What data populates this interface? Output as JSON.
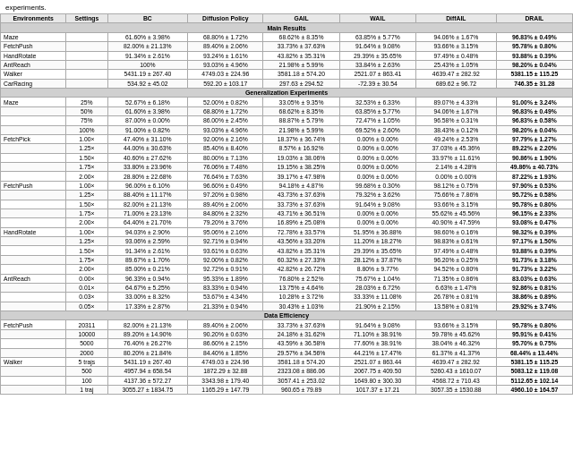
{
  "intro": "experiments.",
  "table": {
    "columns": [
      "Environments",
      "Settings",
      "BC",
      "Diffusion Policy",
      "GAIL",
      "WAIL",
      "DiffAIL",
      "DRAIL"
    ],
    "mainResults": {
      "header": "Main Results",
      "rows": [
        [
          "Maze",
          "",
          "61.60% ± 3.98%",
          "68.80% ± 1.72%",
          "68.62% ± 8.35%",
          "63.85% ± 5.77%",
          "94.06% ± 1.67%",
          "96.83% ± 0.49%"
        ],
        [
          "FetchPush",
          "",
          "82.00% ± 21.13%",
          "89.40% ± 2.06%",
          "33.73% ± 37.63%",
          "91.64% ± 9.08%",
          "93.66% ± 3.15%",
          "95.78% ± 0.80%"
        ],
        [
          "HandRotate",
          "",
          "91.34% ± 2.61%",
          "93.24% ± 1.61%",
          "43.82% ± 35.31%",
          "29.39% ± 35.65%",
          "97.49% ± 0.48%",
          "93.88% ± 0.39%"
        ],
        [
          "AntReach",
          "",
          "100%",
          "93.03% ± 4.96%",
          "21.98% ± 5.99%",
          "33.84% ± 2.63%",
          "25.43% ± 1.05%",
          "98.20% ± 0.04%"
        ],
        [
          "Walker",
          "",
          "5431.19 ± 267.40",
          "4749.03 ± 224.96",
          "3581.18 ± 574.20",
          "2521.07 ± 863.41",
          "4639.47 ± 282.92",
          "5381.15 ± 115.25"
        ],
        [
          "CarRacing",
          "",
          "534.92 ± 45.02",
          "592.20 ± 103.17",
          "297.63 ± 294.52",
          "-72.39 ± 30.54",
          "689.62 ± 96.72",
          "746.35 ± 31.28"
        ]
      ]
    },
    "genExperiments": {
      "header": "Generalization Experiments",
      "mazeRows": [
        [
          "Maze",
          "25%",
          "52.67% ± 6.18%",
          "52.00% ± 0.82%",
          "33.05% ± 9.35%",
          "32.53% ± 6.33%",
          "89.07% ± 4.33%",
          "91.00% ± 3.24%"
        ],
        [
          "",
          "50%",
          "61.60% ± 3.98%",
          "68.80% ± 1.72%",
          "68.62% ± 8.35%",
          "63.85% ± 5.77%",
          "94.06% ± 1.67%",
          "96.83% ± 0.49%"
        ],
        [
          "",
          "75%",
          "87.00% ± 0.00%",
          "86.00% ± 2.45%",
          "88.87% ± 5.79%",
          "72.47% ± 1.05%",
          "96.58% ± 0.31%",
          "96.83% ± 0.58%"
        ],
        [
          "",
          "100%",
          "91.00% ± 0.82%",
          "93.03% ± 4.96%",
          "21.98% ± 5.99%",
          "69.52% ± 2.60%",
          "38.43% ± 0.12%",
          "98.20% ± 0.04%"
        ]
      ],
      "fetchPickRows": [
        [
          "FetchPick",
          "1.00×",
          "47.40% ± 31.10%",
          "92.00% ± 2.16%",
          "18.37% ± 36.74%",
          "0.00% ± 0.00%",
          "49.24% ± 2.53%",
          "97.79% ± 1.27%"
        ],
        [
          "",
          "1.25×",
          "44.00% ± 30.63%",
          "85.40% ± 8.40%",
          "8.57% ± 16.92%",
          "0.00% ± 0.00%",
          "37.03% ± 45.36%",
          "89.22% ± 2.20%"
        ],
        [
          "",
          "1.50×",
          "40.60% ± 27.62%",
          "80.00% ± 7.13%",
          "19.03% ± 38.06%",
          "0.00% ± 0.00%",
          "33.97% ± 11.61%",
          "90.86% ± 1.90%"
        ],
        [
          "",
          "1.75×",
          "33.80% ± 23.96%",
          "76.06% ± 7.48%",
          "19.15% ± 38.25%",
          "0.00% ± 0.00%",
          "2.14% ± 4.28%",
          "49.86% ± 40.73%"
        ],
        [
          "",
          "2.00×",
          "28.80% ± 22.68%",
          "76.64% ± 7.63%",
          "39.17% ± 47.98%",
          "0.00% ± 0.00%",
          "0.00% ± 0.00%",
          "87.22% ± 1.93%"
        ]
      ],
      "fetchPushRows": [
        [
          "FetchPush",
          "1.00×",
          "96.00% ± 6.10%",
          "96.60% ± 0.49%",
          "94.18% ± 4.87%",
          "99.68% ± 0.30%",
          "98.12% ± 0.75%",
          "97.90% ± 0.53%"
        ],
        [
          "",
          "1.25×",
          "88.40% ± 11.17%",
          "97.20% ± 0.98%",
          "43.73% ± 37.63%",
          "79.32% ± 3.62%",
          "75.66% ± 7.86%",
          "95.72% ± 0.58%"
        ],
        [
          "",
          "1.50×",
          "82.00% ± 21.13%",
          "89.40% ± 2.06%",
          "33.73% ± 37.63%",
          "91.64% ± 9.08%",
          "93.66% ± 3.15%",
          "95.78% ± 0.80%"
        ],
        [
          "",
          "1.75×",
          "71.00% ± 23.13%",
          "84.80% ± 2.32%",
          "43.71% ± 36.51%",
          "0.00% ± 0.00%",
          "55.62% ± 45.56%",
          "96.15% ± 2.33%"
        ],
        [
          "",
          "2.00×",
          "64.40% ± 21.70%",
          "79.20% ± 3.76%",
          "16.89% ± 25.08%",
          "0.00% ± 0.00%",
          "40.90% ± 47.59%",
          "93.08% ± 0.47%"
        ]
      ],
      "handRotateRows": [
        [
          "HandRotate",
          "1.00×",
          "94.03% ± 2.90%",
          "95.06% ± 2.16%",
          "72.78% ± 33.57%",
          "51.95% ± 36.88%",
          "98.60% ± 0.16%",
          "98.32% ± 0.39%"
        ],
        [
          "",
          "1.25×",
          "93.06% ± 2.59%",
          "92.71% ± 0.94%",
          "43.56% ± 33.20%",
          "11.20% ± 18.27%",
          "98.83% ± 0.61%",
          "97.17% ± 1.50%"
        ],
        [
          "",
          "1.50×",
          "91.34% ± 2.61%",
          "93.61% ± 0.63%",
          "43.82% ± 35.31%",
          "29.39% ± 35.65%",
          "97.49% ± 0.48%",
          "93.88% ± 0.39%"
        ],
        [
          "",
          "1.75×",
          "89.67% ± 1.70%",
          "92.00% ± 0.82%",
          "60.32% ± 27.33%",
          "28.12% ± 37.87%",
          "96.20% ± 0.25%",
          "91.73% ± 3.18%"
        ],
        [
          "",
          "2.00×",
          "85.00% ± 0.21%",
          "92.72% ± 0.91%",
          "42.82% ± 26.72%",
          "8.80% ± 9.77%",
          "94.52% ± 0.80%",
          "91.73% ± 3.22%"
        ]
      ],
      "antReachRows": [
        [
          "AntReach",
          "0.00×",
          "96.33% ± 0.94%",
          "95.33% ± 1.89%",
          "76.80% ± 2.52%",
          "75.67% ± 1.04%",
          "71.35% ± 0.86%",
          "83.03% ± 0.63%"
        ],
        [
          "",
          "0.01×",
          "64.67% ± 5.25%",
          "83.33% ± 0.94%",
          "13.75% ± 4.64%",
          "28.03% ± 6.72%",
          "6.63% ± 1.47%",
          "92.86% ± 0.81%"
        ],
        [
          "",
          "0.03×",
          "33.00% ± 8.32%",
          "53.67% ± 4.34%",
          "10.28% ± 3.72%",
          "33.33% ± 11.08%",
          "26.78% ± 0.81%",
          "38.86% ± 0.89%"
        ],
        [
          "",
          "0.05×",
          "17.33% ± 2.87%",
          "21.33% ± 0.94%",
          "30.43% ± 1.03%",
          "21.90% ± 2.15%",
          "13.58% ± 0.81%",
          "29.92% ± 3.74%"
        ]
      ]
    },
    "dataEfficiency": {
      "header": "Data Efficiency",
      "fetchPushRows": [
        [
          "FetchPush",
          "20311",
          "82.00% ± 21.13%",
          "89.40% ± 2.06%",
          "33.73% ± 37.63%",
          "91.64% ± 9.08%",
          "93.66% ± 3.15%",
          "95.78% ± 0.80%"
        ],
        [
          "",
          "10000",
          "89.20% ± 14.90%",
          "90.20% ± 0.63%",
          "24.18% ± 31.62%",
          "71.10% ± 38.91%",
          "59.78% ± 45.62%",
          "95.91% ± 0.41%"
        ],
        [
          "",
          "5000",
          "76.40% ± 26.27%",
          "86.60% ± 2.15%",
          "43.59% ± 36.58%",
          "77.60% ± 38.91%",
          "38.04% ± 46.32%",
          "95.70% ± 0.75%"
        ],
        [
          "",
          "2000",
          "80.20% ± 21.84%",
          "84.40% ± 1.85%",
          "29.57% ± 34.56%",
          "44.21% ± 17.47%",
          "61.37% ± 41.37%",
          "68.44% ± 13.44%"
        ]
      ],
      "walkerRows": [
        [
          "Walker",
          "5 trajs",
          "5431.19 ± 267.40",
          "4749.03 ± 224.96",
          "3581.18 ± 574.20",
          "2521.07 ± 863.44",
          "4639.47 ± 282.92",
          "5381.15 ± 115.25"
        ],
        [
          "",
          "500",
          "4957.94 ± 658.54",
          "1872.29 ± 32.88",
          "2323.08 ± 886.06",
          "2067.75 ± 409.50",
          "5260.43 ± 1610.07",
          "5083.12 ± 119.08"
        ],
        [
          "",
          "100",
          "4137.36 ± 572.27",
          "3343.98 ± 179.40",
          "3057.41 ± 253.02",
          "1649.80 ± 300.30",
          "4568.72 ± 710.43",
          "5112.65 ± 102.14"
        ],
        [
          "",
          "1 traj",
          "3055.27 ± 1834.75",
          "1165.29 ± 147.79",
          "960.65 ± 79.89",
          "1017.37 ± 17.21",
          "3057.35 ± 1530.88",
          "4960.10 ± 164.57"
        ]
      ]
    }
  }
}
